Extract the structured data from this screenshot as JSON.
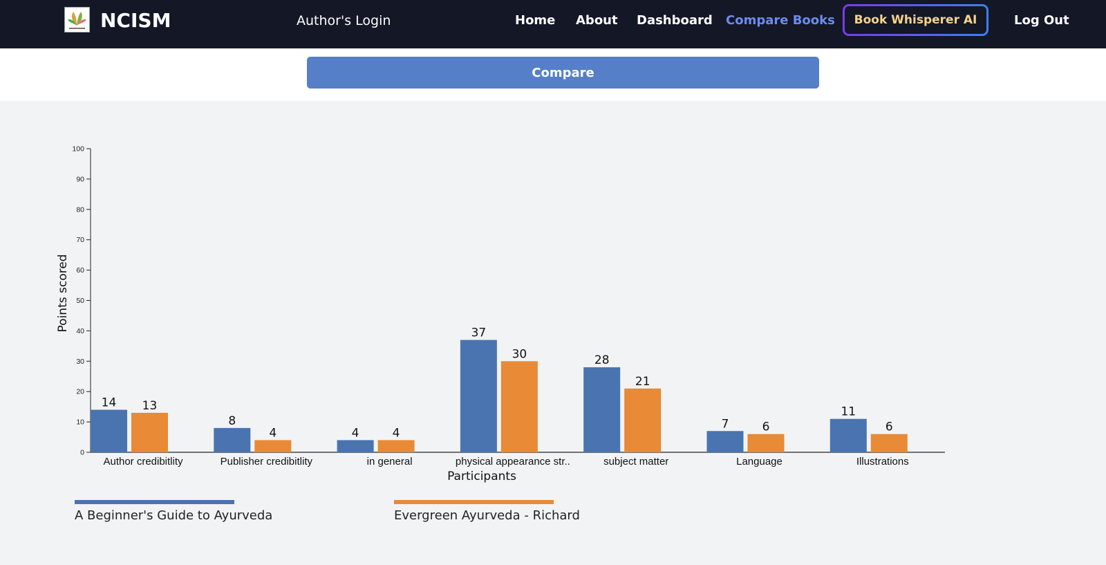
{
  "nav": {
    "brand": "NCISM",
    "author_login": "Author's Login",
    "links": [
      "Home",
      "About",
      "Dashboard",
      "Compare Books"
    ],
    "ai_button": "Book Whisperer AI",
    "logout": "Log Out"
  },
  "compare_button": "Compare",
  "colors": {
    "series_a": "#4a74b0",
    "series_b": "#e88a36",
    "nav_bg": "#141726",
    "active_link": "#6b8cf0"
  },
  "chart_data": {
    "type": "bar",
    "categories": [
      "Author credibitlity",
      "Publisher credibitlity",
      "in general",
      "physical appearance str..",
      "subject matter",
      "Language",
      "Illustrations"
    ],
    "series": [
      {
        "name": "A Beginner's Guide to Ayurveda",
        "values": [
          14,
          8,
          4,
          37,
          28,
          7,
          11
        ]
      },
      {
        "name": "Evergreen Ayurveda - Richard",
        "values": [
          13,
          4,
          4,
          30,
          21,
          6,
          6
        ]
      }
    ],
    "xlabel": "Participants",
    "ylabel": "Points scored",
    "ylim": [
      0,
      100
    ],
    "yticks": [
      0,
      10,
      20,
      30,
      40,
      50,
      60,
      70,
      80,
      90,
      100
    ],
    "grid": false,
    "legend": "bottom-left"
  }
}
